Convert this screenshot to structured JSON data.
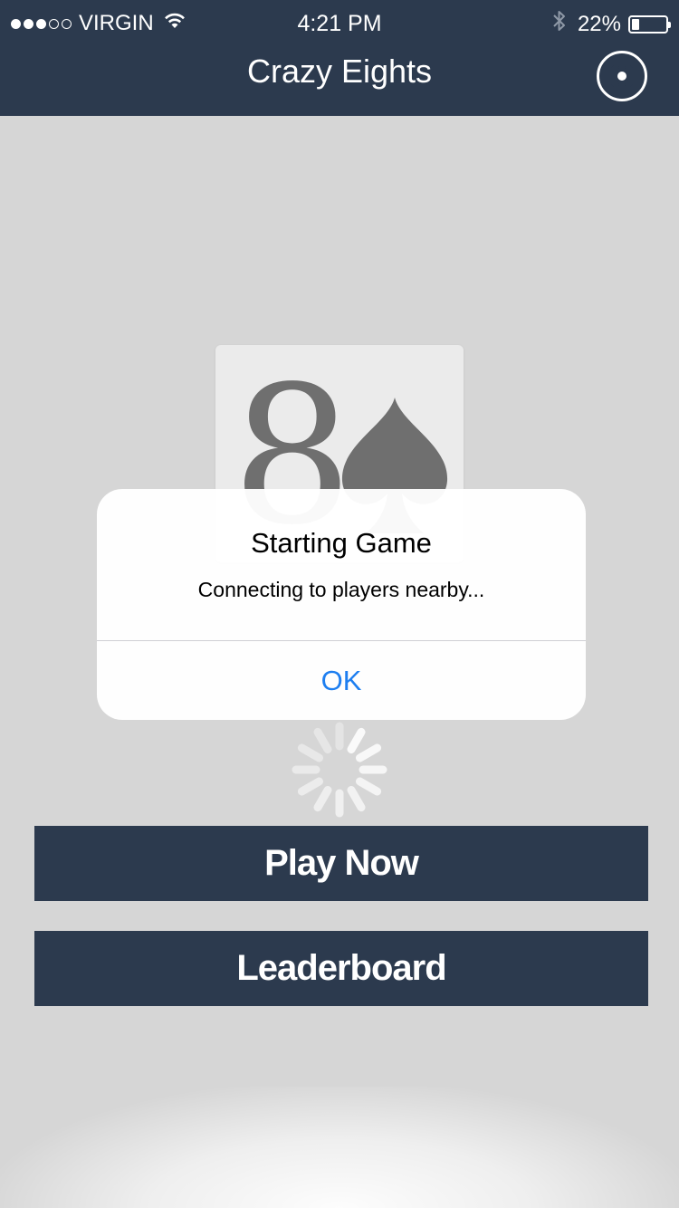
{
  "status_bar": {
    "carrier": "VIRGIN",
    "signal_bars_filled": 3,
    "signal_bars_total": 5,
    "time": "4:21 PM",
    "battery_percent_label": "22%",
    "battery_level": 0.22
  },
  "navbar": {
    "title": "Crazy Eights",
    "settings_icon": "gear-icon",
    "background_color": "#2c3a4e"
  },
  "card": {
    "rank": "8",
    "suit_icon": "spade-icon"
  },
  "alert": {
    "title": "Starting Game",
    "message": "Connecting to players nearby...",
    "ok_label": "OK",
    "ok_color": "#1d7ef0"
  },
  "buttons": {
    "play_now": "Play Now",
    "leaderboard": "Leaderboard"
  },
  "colors": {
    "background": "#d6d6d6",
    "primary": "#2c3a4e"
  }
}
